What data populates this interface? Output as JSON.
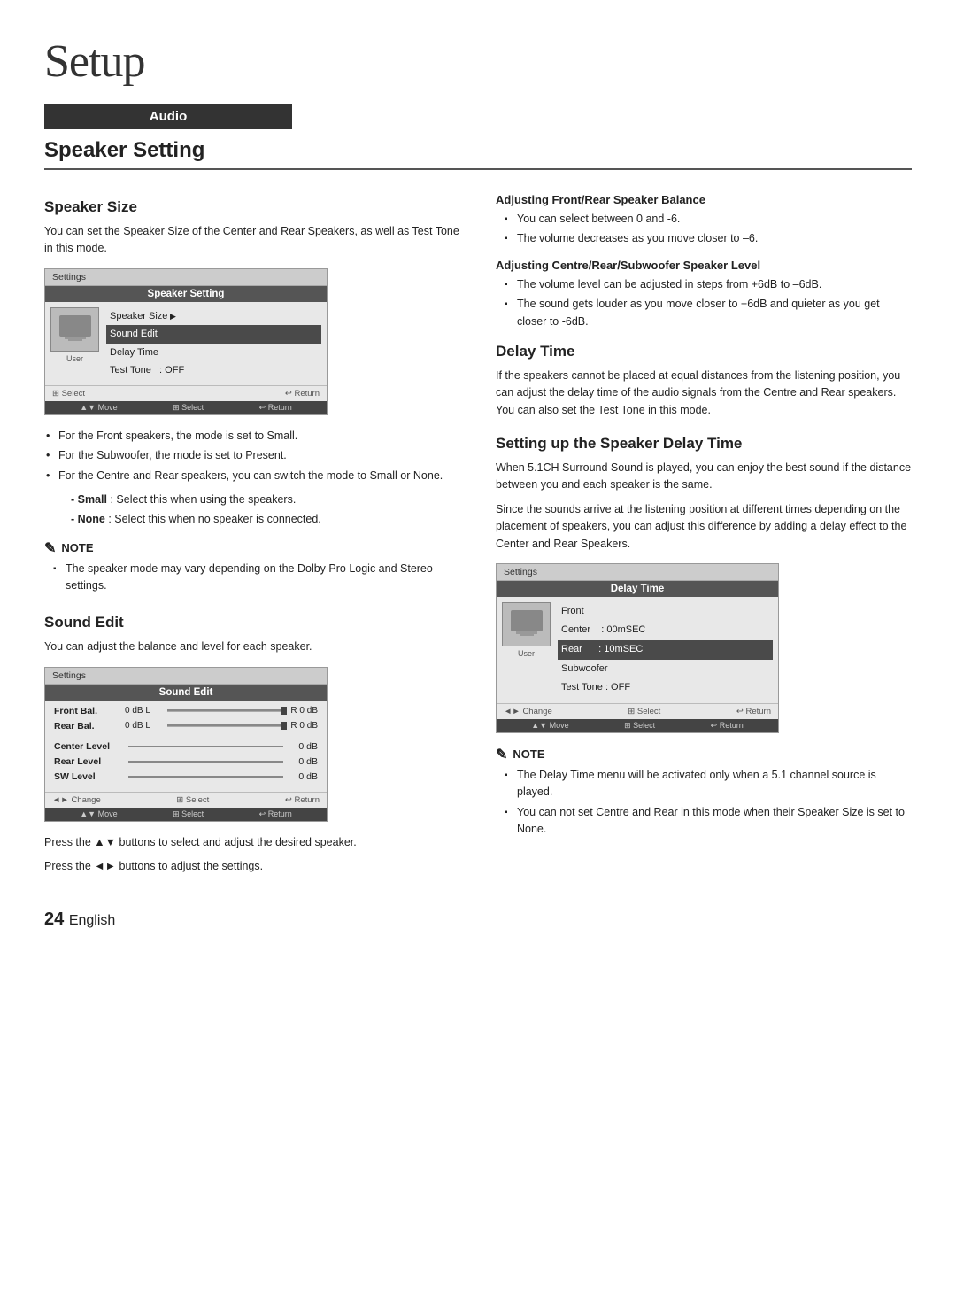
{
  "page": {
    "title": "Setup",
    "page_number": "24",
    "page_language": "English"
  },
  "audio_badge": "Audio",
  "section": {
    "title": "Speaker Setting"
  },
  "speaker_size": {
    "heading": "Speaker Size",
    "body": "You can set the Speaker Size of the Center and Rear Speakers, as well as Test Tone in this mode.",
    "screen": {
      "title_bar": "Settings",
      "header": "Speaker Setting",
      "menu_items": [
        {
          "label": "Speaker Size",
          "arrow": true,
          "highlighted": false
        },
        {
          "label": "Sound Edit",
          "arrow": false,
          "highlighted": false
        },
        {
          "label": "Delay Time",
          "arrow": false,
          "highlighted": false
        },
        {
          "label": "Test Tone",
          "value": ": OFF",
          "highlighted": false
        }
      ],
      "footer": "Select",
      "footer2": "Move   Select   Return"
    },
    "bullets": [
      "For the Front speakers, the mode is set to Small.",
      "For the Subwoofer, the mode is set to Present.",
      "For the Centre and Rear speakers, you can switch the mode to Small or None."
    ],
    "dash_items": [
      "- Small : Select this when using the speakers.",
      "- None : Select this when no speaker is connected."
    ],
    "note": {
      "title": "NOTE",
      "items": [
        "The speaker mode may vary depending on the Dolby Pro Logic and Stereo settings."
      ]
    }
  },
  "sound_edit": {
    "heading": "Sound Edit",
    "body": "You can adjust the balance and level for each speaker.",
    "screen": {
      "title_bar": "Settings",
      "header": "Sound Edit",
      "rows": [
        {
          "label": "Front Bal.",
          "left": "0 dB L",
          "right": "R 0 dB",
          "has_bar": true
        },
        {
          "label": "Rear Bal.",
          "left": "0 dB L",
          "right": "R 0 dB",
          "has_bar": true
        }
      ],
      "levels": [
        {
          "label": "Center Level",
          "value": "0 dB"
        },
        {
          "label": "Rear Level",
          "value": "0 dB"
        },
        {
          "label": "SW Level",
          "value": "0 dB"
        }
      ],
      "footer": "Change   Select   Return",
      "footer2": "Move   Select   Return"
    },
    "press_arrows": "Press the ▲▼ buttons to select and adjust the desired speaker.",
    "press_lr": "Press the ◄► buttons to adjust the settings."
  },
  "adjusting_front_rear": {
    "heading": "Adjusting Front/Rear Speaker Balance",
    "bullets": [
      "You can select between 0 and -6.",
      "The volume decreases as you move closer to –6."
    ]
  },
  "adjusting_centre": {
    "heading": "Adjusting Centre/Rear/Subwoofer Speaker Level",
    "bullets": [
      "The volume level can be adjusted in steps from +6dB to –6dB.",
      "The sound gets louder as you move closer to +6dB and quieter as you get closer to -6dB."
    ]
  },
  "delay_time": {
    "heading": "Delay Time",
    "body": "If the speakers cannot be placed at equal distances from the listening position, you can adjust the delay time of the audio signals from the Centre and  Rear speakers. You can also set the Test Tone in this mode.",
    "setting_up": {
      "heading": "Setting up the Speaker Delay Time",
      "body1": "When 5.1CH Surround Sound is played, you can enjoy the best sound if the distance between you and each speaker is the same.",
      "body2": "Since the sounds arrive at the listening position at different times depending on the placement of speakers, you can adjust this difference by adding a delay effect to the Center and Rear Speakers."
    },
    "screen": {
      "title_bar": "Settings",
      "header": "Delay Time",
      "items": [
        {
          "label": "Front",
          "value": "",
          "highlighted": false
        },
        {
          "label": "Center",
          "value": ": 00mSEC",
          "highlighted": false
        },
        {
          "label": "Rear",
          "value": ": 10mSEC",
          "highlighted": false
        },
        {
          "label": "Subwoofer",
          "value": "",
          "highlighted": false
        },
        {
          "label": "Test Tone",
          "value": ": OFF",
          "highlighted": false
        }
      ],
      "footer": "Change   Select   Return",
      "footer2": "Move   Select   Return"
    },
    "note": {
      "title": "NOTE",
      "items": [
        "The Delay Time menu will be activated only when a 5.1 channel source is played.",
        "You can not set Centre and Rear in this mode when their Speaker Size is set to None."
      ]
    }
  }
}
